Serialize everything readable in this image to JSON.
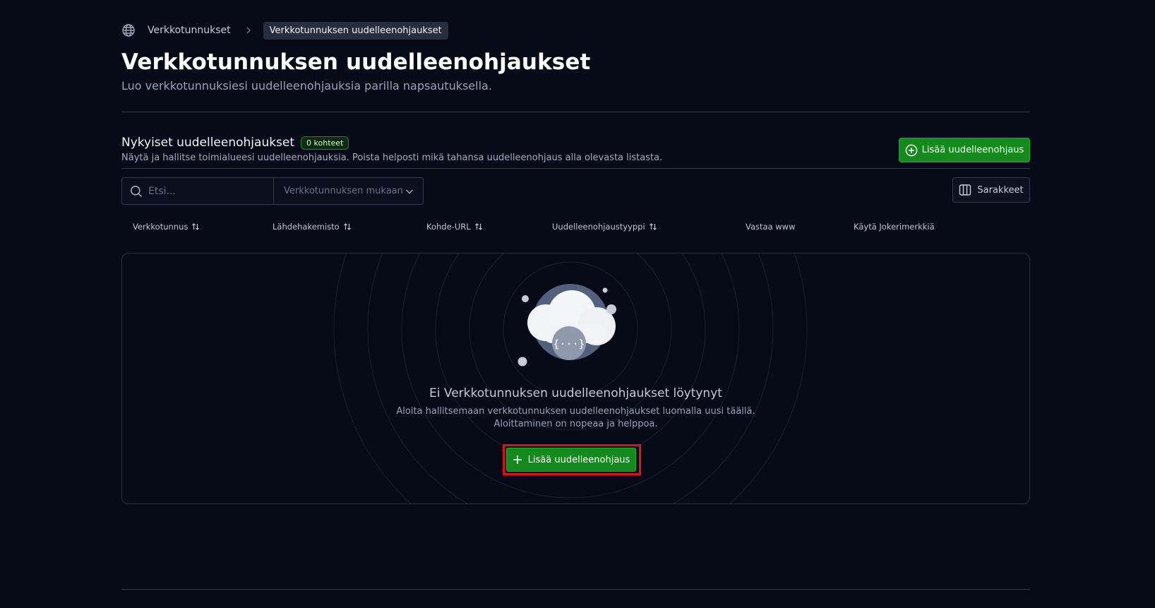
{
  "breadcrumb": {
    "root_label": "Verkkotunnukset",
    "current_label": "Verkkotunnuksen uudelleenohjaukset",
    "root_icon": "globe-icon",
    "separator_icon": "chevron-right-icon"
  },
  "page": {
    "title": "Verkkotunnuksen uudelleenohjaukset",
    "subtitle": "Luo verkkotunnuksiesi uudelleenohjauksia parilla napsautuksella."
  },
  "section": {
    "title": "Nykyiset uudelleenohjaukset",
    "badge": "0 kohteet",
    "description": "Näytä ja hallitse toimialueesi uudelleenohjauksia. Poista helposti mikä tahansa uudelleenohjaus alla olevasta listasta.",
    "add_button_label": "Lisää uudelleenohjaus",
    "add_button_icon": "plus-circle-icon"
  },
  "filters": {
    "search_placeholder": "Etsi...",
    "search_icon": "search-icon",
    "domain_select_label": "Verkkotunnuksen mukaan",
    "columns_button_label": "Sarakkeet",
    "columns_icon": "columns-icon"
  },
  "table": {
    "columns": [
      {
        "label": "Verkkotunnus",
        "sortable": true
      },
      {
        "label": "Lähdehakemisto",
        "sortable": true
      },
      {
        "label": "Kohde-URL",
        "sortable": true
      },
      {
        "label": "Uudelleenohjaustyyppi",
        "sortable": true
      },
      {
        "label": "Vastaa www",
        "sortable": false
      },
      {
        "label": "Käytä Jokerimerkkiä",
        "sortable": false
      }
    ]
  },
  "empty_state": {
    "title": "Ei Verkkotunnuksen uudelleenohjaukset löytynyt",
    "description_line1": "Aloita hallitsemaan verkkotunnuksen uudelleenohjaukset luomalla uusi täällä.",
    "description_line2": "Aloittaminen on nopeaa ja helppoa.",
    "button_label": "Lisää uudelleenohjaus",
    "illustration_icon": "cloud-icon",
    "illustration_glyph": "{···}"
  },
  "colors": {
    "background": "#070b18",
    "accent_green": "#148a1c",
    "highlight_red": "#e0140f"
  }
}
